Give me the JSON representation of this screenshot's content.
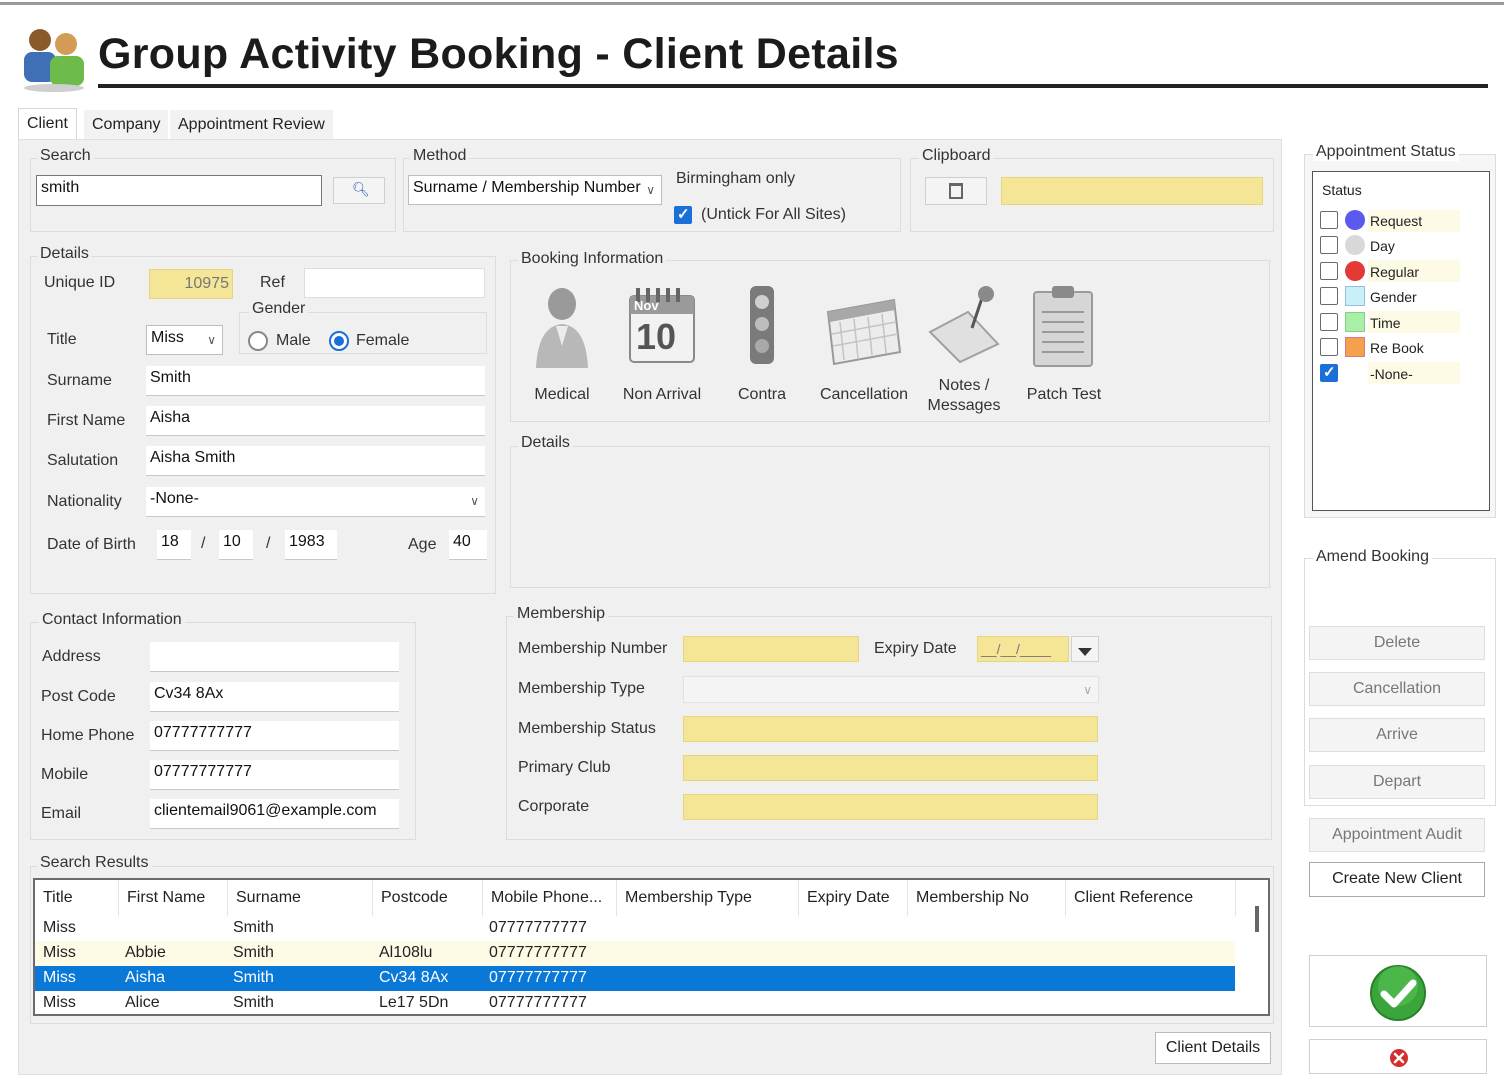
{
  "window": {
    "title": "Group Activity Booking - Client Details"
  },
  "tabs": [
    {
      "label": "Client"
    },
    {
      "label": "Company"
    },
    {
      "label": "Appointment Review"
    }
  ],
  "search": {
    "legend": "Search",
    "value": "smith"
  },
  "method": {
    "legend": "Method",
    "selected": "Surname / Membership Number",
    "site_note": "Birmingham only",
    "untick_label": "(Untick For All Sites)",
    "untick_checked": true
  },
  "clipboard": {
    "legend": "Clipboard",
    "value": ""
  },
  "details": {
    "legend": "Details",
    "unique_id_label": "Unique ID",
    "unique_id": "10975",
    "ref_label": "Ref",
    "ref": "",
    "gender_legend": "Gender",
    "male_label": "Male",
    "female_label": "Female",
    "gender": "Female",
    "title_label": "Title",
    "title": "Miss",
    "surname_label": "Surname",
    "surname": "Smith",
    "first_name_label": "First Name",
    "first_name": "Aisha",
    "salutation_label": "Salutation",
    "salutation": "Aisha Smith",
    "nationality_label": "Nationality",
    "nationality": "-None-",
    "dob_label": "Date of Birth",
    "dob_day": "18",
    "dob_month": "10",
    "dob_year": "1983",
    "dob_sep": "/",
    "age_label": "Age",
    "age": "40"
  },
  "booking": {
    "legend": "Booking Information",
    "items": [
      {
        "label": "Medical",
        "icon": "medical-person-icon"
      },
      {
        "label": "Non Arrival",
        "icon": "calendar-nov-10-icon",
        "cal_month": "Nov",
        "cal_day": "10"
      },
      {
        "label": "Contra",
        "icon": "traffic-light-icon"
      },
      {
        "label": "Cancellation",
        "icon": "calendar-grid-icon"
      },
      {
        "label": "Notes / Messages",
        "icon": "pinned-note-icon"
      },
      {
        "label": "Patch Test",
        "icon": "clipboard-icon"
      }
    ],
    "details_legend": "Details"
  },
  "contact": {
    "legend": "Contact Information",
    "address_label": "Address",
    "address": "",
    "postcode_label": "Post Code",
    "postcode": "Cv34 8Ax",
    "home_phone_label": "Home Phone",
    "home_phone": "07777777777",
    "mobile_label": "Mobile",
    "mobile": "07777777777",
    "email_label": "Email",
    "email": "clientemail9061@example.com"
  },
  "membership": {
    "legend": "Membership",
    "number_label": "Membership Number",
    "number": "",
    "expiry_label": "Expiry Date",
    "expiry": "__/__/____",
    "type_label": "Membership Type",
    "type": "",
    "status_label": "Membership Status",
    "status": "",
    "club_label": "Primary Club",
    "club": "",
    "corporate_label": "Corporate",
    "corporate": ""
  },
  "results": {
    "legend": "Search Results",
    "columns": [
      "Title",
      "First Name",
      "Surname",
      "Postcode",
      "Mobile Phone...",
      "Membership Type",
      "Expiry Date",
      "Membership No",
      "Client Reference"
    ],
    "rows": [
      {
        "title": "Miss",
        "first": "",
        "surname": "Smith",
        "postcode": "",
        "mobile": "07777777777"
      },
      {
        "title": "Miss",
        "first": "Abbie",
        "surname": "Smith",
        "postcode": "Al108lu",
        "mobile": "07777777777"
      },
      {
        "title": "Miss",
        "first": "Aisha",
        "surname": "Smith",
        "postcode": "Cv34 8Ax",
        "mobile": "07777777777"
      },
      {
        "title": "Miss",
        "first": "Alice",
        "surname": "Smith",
        "postcode": "Le17 5Dn",
        "mobile": "07777777777"
      }
    ],
    "selected_row": 2,
    "client_details_button": "Client Details"
  },
  "appointment_status": {
    "legend": "Appointment Status",
    "header": "Status",
    "items": [
      {
        "label": "Request",
        "color": "#5a5af0",
        "checked": false
      },
      {
        "label": "Day",
        "color": "#d8d8d8",
        "checked": false
      },
      {
        "label": "Regular",
        "color": "#e53935",
        "checked": false
      },
      {
        "label": "Gender",
        "color": "#c8f0f8",
        "checked": false
      },
      {
        "label": "Time",
        "color": "#a8f0a8",
        "checked": false
      },
      {
        "label": "Re Book",
        "color": "#f5a04a",
        "checked": false
      },
      {
        "label": "-None-",
        "color": "",
        "checked": true
      }
    ]
  },
  "amend": {
    "legend": "Amend Booking",
    "delete": "Delete",
    "cancellation": "Cancellation",
    "arrive": "Arrive",
    "depart": "Depart"
  },
  "side": {
    "audit": "Appointment Audit",
    "create": "Create New Client"
  },
  "colors": {
    "accent": "#1a6fd8",
    "selected_row": "#0a78d7",
    "yellow_field": "#f5e596",
    "ok_green": "#3aa53a",
    "cancel_red": "#d32f2f"
  }
}
